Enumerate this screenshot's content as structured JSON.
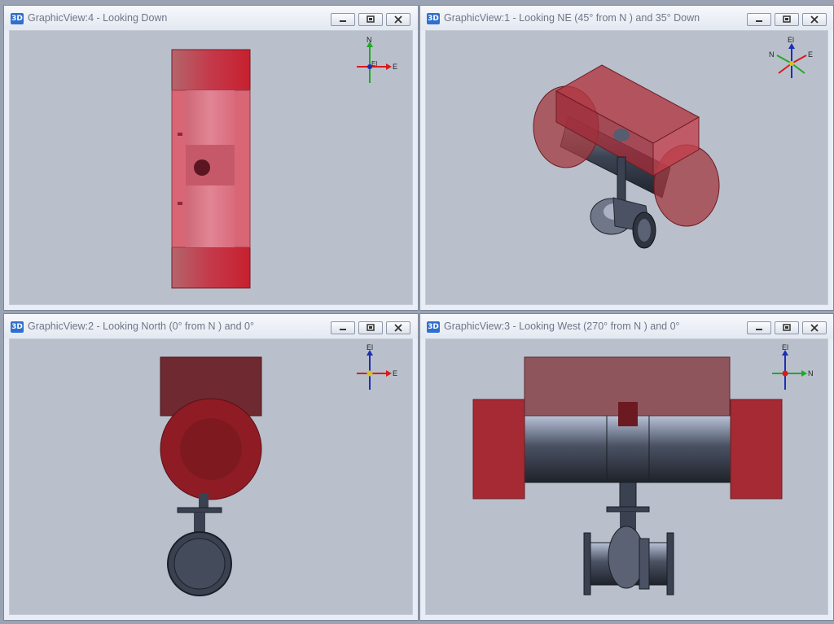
{
  "panes": [
    {
      "title": "GraphicView:4 - Looking Down",
      "icon": "3D"
    },
    {
      "title": "GraphicView:1 - Looking NE (45° from N ) and 35° Down",
      "icon": "3D"
    },
    {
      "title": "GraphicView:2 - Looking North (0° from N ) and 0°",
      "icon": "3D"
    },
    {
      "title": "GraphicView:3 - Looking West (270° from N ) and 0°",
      "icon": "3D"
    }
  ],
  "triads": {
    "down": {
      "up": "N",
      "right": "E",
      "center": "El"
    },
    "ne": {
      "up": "El",
      "left": "N",
      "right": "E"
    },
    "north": {
      "up": "El",
      "right": "E"
    },
    "west": {
      "up": "El",
      "right": "N"
    }
  },
  "colors": {
    "viewport_bg": "#b9c0cc",
    "red_solid": "#b42531",
    "steel": "#3a4150",
    "axis_x": "#d81b1b",
    "axis_y": "#1faa22",
    "axis_z": "#1c2fb3"
  }
}
